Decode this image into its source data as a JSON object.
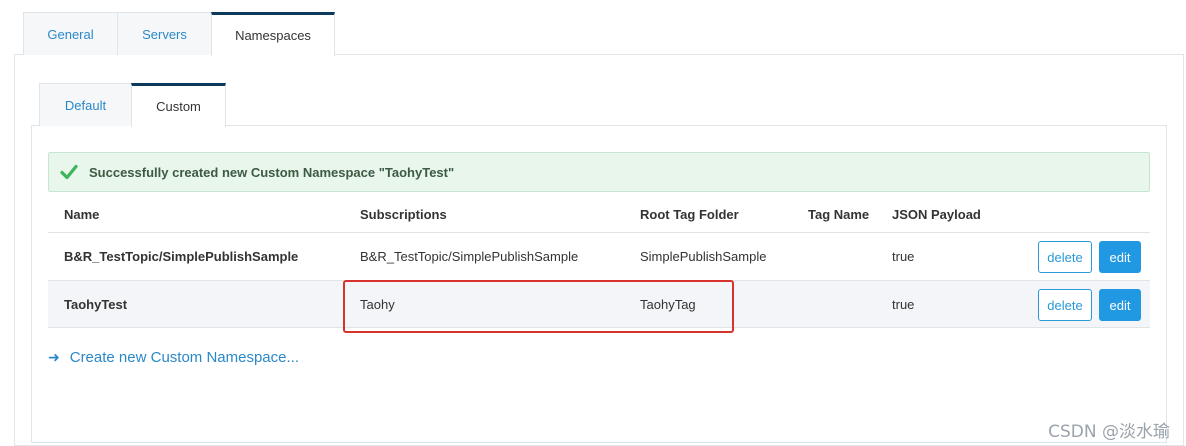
{
  "top_tabs": [
    {
      "label": "General"
    },
    {
      "label": "Servers"
    },
    {
      "label": "Namespaces"
    }
  ],
  "sub_tabs": [
    {
      "label": "Default"
    },
    {
      "label": "Custom"
    }
  ],
  "alert": {
    "message": "Successfully created new Custom Namespace \"TaohyTest\"",
    "color": "#3cb55b"
  },
  "table": {
    "headers": [
      "Name",
      "Subscriptions",
      "Root Tag Folder",
      "Tag Name",
      "JSON Payload"
    ],
    "rows": [
      {
        "name": "B&R_TestTopic/SimplePublishSample",
        "subscriptions": "B&R_TestTopic/SimplePublishSample",
        "root_tag_folder": "SimplePublishSample",
        "tag_name": "",
        "json_payload": "true",
        "delete_label": "delete",
        "edit_label": "edit"
      },
      {
        "name": "TaohyTest",
        "subscriptions": "Taohy",
        "root_tag_folder": "TaohyTag",
        "tag_name": "",
        "json_payload": "true",
        "delete_label": "delete",
        "edit_label": "edit"
      }
    ]
  },
  "create_link": "Create new Custom Namespace...",
  "watermark": "CSDN @淡水瑜",
  "colors": {
    "accent": "#2198e2",
    "tab_active_border": "#0d3a5c",
    "annotation_box": "#d6332c"
  }
}
